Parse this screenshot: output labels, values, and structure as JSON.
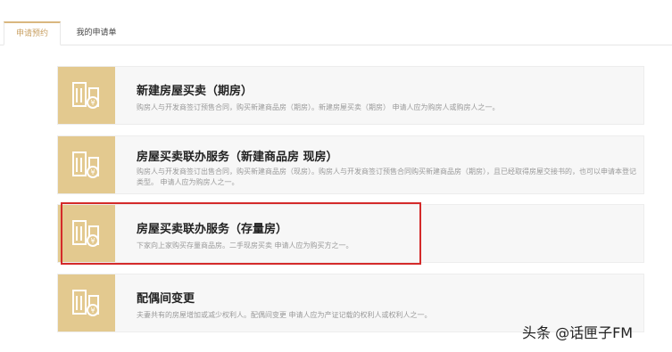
{
  "tabs": [
    {
      "label": "申请预约",
      "active": true
    },
    {
      "label": "我的申请单",
      "active": false
    }
  ],
  "services": [
    {
      "title": "新建房屋买卖（期房）",
      "desc": "购房人与开发商签订预售合同，购买新建商品房（期房）。新建房屋买卖（期房） 申请人应为购房人或购房人之一。"
    },
    {
      "title": "房屋买卖联办服务（新建商品房 现房）",
      "desc": "购房人与开发商签订出售合同，购买新建商品房（现房）。购房人与开发商签订预售合同购买新建商品房（期房），且已经取得房屋交接书的，也可以申请本登记类型。 申请人应为购房人之一。"
    },
    {
      "title": "房屋买卖联办服务（存量房）",
      "desc": "下家向上家购买存量商品房。二手现房买卖 申请人应为购买方之一。"
    },
    {
      "title": "配偶间变更",
      "desc": "夫妻共有的房屋增加或减少权利人。配偶间变更 申请人应为产证记载的权利人或权利人之一。"
    }
  ],
  "colors": {
    "accent": "#e3c98f",
    "tab_active": "#c9a063",
    "highlight": "#d42a2a"
  },
  "icon_name": "building-document-icon",
  "watermark": "头条 @话匣子FM"
}
